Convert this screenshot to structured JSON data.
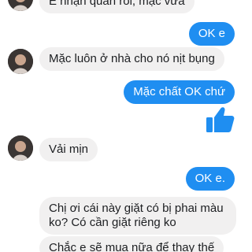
{
  "messages": [
    {
      "side": "in",
      "text": "E nhận quần rồi, mặc vừa"
    },
    {
      "side": "out",
      "text": "OK e"
    },
    {
      "side": "in",
      "text": "Mặc luôn ở nhà cho nó nịt bụng"
    },
    {
      "side": "out",
      "text": "Mặc chất OK chứ"
    },
    {
      "side": "out",
      "type": "like",
      "icon": "thumbs-up-icon"
    },
    {
      "side": "in",
      "text": "Vải mịn"
    },
    {
      "side": "out",
      "text": "OK e."
    },
    {
      "side": "in",
      "text": "Chị ơi cái này giặt có bị phai màu ko? Có cần giặt riêng ko"
    },
    {
      "side": "in",
      "text": "Chắc e sẽ mua nữa để thay thế"
    }
  ],
  "colors": {
    "incoming_bubble": "#f1f0f0",
    "outgoing_bubble": "#1f8ef1",
    "like_icon": "#1f8ef1"
  }
}
